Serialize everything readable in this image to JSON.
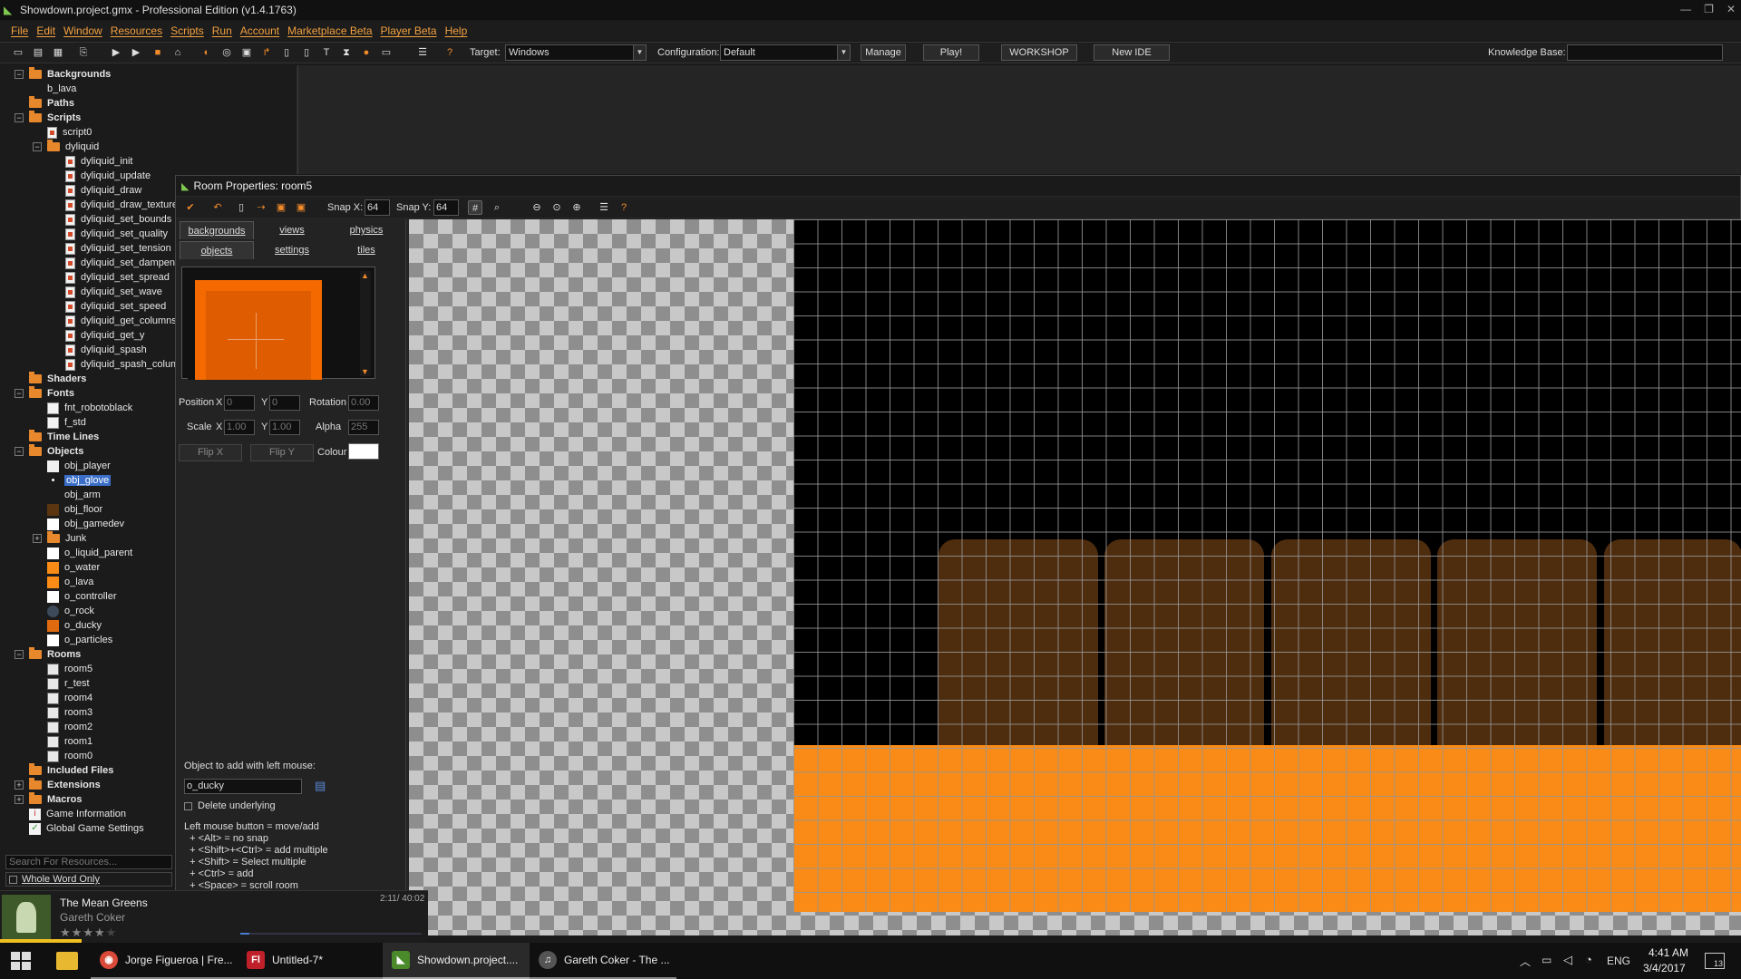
{
  "window": {
    "title": "Showdown.project.gmx  -  Professional Edition (v1.4.1763)",
    "controls": [
      "—",
      "❐",
      "✕"
    ]
  },
  "menu": [
    "File",
    "Edit",
    "Window",
    "Resources",
    "Scripts",
    "Run",
    "Account",
    "Marketplace Beta",
    "Player Beta",
    "Help"
  ],
  "toolbar": {
    "target_label": "Target:",
    "target_value": "Windows",
    "config_label": "Configuration:",
    "config_value": "Default",
    "manage": "Manage",
    "play": "Play!",
    "workshop": "WORKSHOP",
    "new_ide": "New IDE",
    "kb_label": "Knowledge Base:"
  },
  "tree": [
    {
      "label": "Backgrounds",
      "kind": "folder",
      "level": 0,
      "bold": true,
      "exp": "−"
    },
    {
      "label": "b_lava",
      "kind": "none",
      "level": 1
    },
    {
      "label": "Paths",
      "kind": "folder",
      "level": 0,
      "bold": true
    },
    {
      "label": "Scripts",
      "kind": "folder",
      "level": 0,
      "bold": true,
      "exp": "−"
    },
    {
      "label": "script0",
      "kind": "script",
      "level": 1
    },
    {
      "label": "dyliquid",
      "kind": "folder",
      "level": 1,
      "exp": "−"
    },
    {
      "label": "dyliquid_init",
      "kind": "script",
      "level": 2
    },
    {
      "label": "dyliquid_update",
      "kind": "script",
      "level": 2
    },
    {
      "label": "dyliquid_draw",
      "kind": "script",
      "level": 2
    },
    {
      "label": "dyliquid_draw_texture",
      "kind": "script",
      "level": 2
    },
    {
      "label": "dyliquid_set_bounds",
      "kind": "script",
      "level": 2
    },
    {
      "label": "dyliquid_set_quality",
      "kind": "script",
      "level": 2
    },
    {
      "label": "dyliquid_set_tension",
      "kind": "script",
      "level": 2
    },
    {
      "label": "dyliquid_set_dampen",
      "kind": "script",
      "level": 2
    },
    {
      "label": "dyliquid_set_spread",
      "kind": "script",
      "level": 2
    },
    {
      "label": "dyliquid_set_wave",
      "kind": "script",
      "level": 2
    },
    {
      "label": "dyliquid_set_speed",
      "kind": "script",
      "level": 2
    },
    {
      "label": "dyliquid_get_columns",
      "kind": "script",
      "level": 2
    },
    {
      "label": "dyliquid_get_y",
      "kind": "script",
      "level": 2
    },
    {
      "label": "dyliquid_spash",
      "kind": "script",
      "level": 2
    },
    {
      "label": "dyliquid_spash_colum",
      "kind": "script",
      "level": 2
    },
    {
      "label": "Shaders",
      "kind": "folder",
      "level": 0,
      "bold": true
    },
    {
      "label": "Fonts",
      "kind": "folder",
      "level": 0,
      "bold": true,
      "exp": "−"
    },
    {
      "label": "fnt_robotoblack",
      "kind": "font",
      "level": 1
    },
    {
      "label": "f_std",
      "kind": "font",
      "level": 1
    },
    {
      "label": "Time Lines",
      "kind": "folder",
      "level": 0,
      "bold": true
    },
    {
      "label": "Objects",
      "kind": "folder",
      "level": 0,
      "bold": true,
      "exp": "−"
    },
    {
      "label": "obj_player",
      "kind": "sprite",
      "level": 1,
      "color": "#f0f0f0"
    },
    {
      "label": "obj_glove",
      "kind": "sprite",
      "level": 1,
      "color": "#1b1b1b",
      "selected": true
    },
    {
      "label": "obj_arm",
      "kind": "sprite",
      "level": 1,
      "color": "#1b1b1b"
    },
    {
      "label": "obj_floor",
      "kind": "sprite",
      "level": 1,
      "color": "#5a3510"
    },
    {
      "label": "obj_gamedev",
      "kind": "sprite",
      "level": 1,
      "color": "#ffffff"
    },
    {
      "label": "Junk",
      "kind": "folder",
      "level": 1,
      "exp": "+"
    },
    {
      "label": "o_liquid_parent",
      "kind": "sprite",
      "level": 1,
      "color": "#ffffff"
    },
    {
      "label": "o_water",
      "kind": "sprite",
      "level": 1,
      "color": "#f98b16"
    },
    {
      "label": "o_lava",
      "kind": "sprite",
      "level": 1,
      "color": "#f98b16"
    },
    {
      "label": "o_controller",
      "kind": "sprite",
      "level": 1,
      "color": "#ffffff"
    },
    {
      "label": "o_rock",
      "kind": "sprite",
      "level": 1,
      "color": "#3c4a5a"
    },
    {
      "label": "o_ducky",
      "kind": "sprite",
      "level": 1,
      "color": "#e06a10"
    },
    {
      "label": "o_particles",
      "kind": "sprite",
      "level": 1,
      "color": "#ffffff"
    },
    {
      "label": "Rooms",
      "kind": "folder",
      "level": 0,
      "bold": true,
      "exp": "−"
    },
    {
      "label": "room5",
      "kind": "room",
      "level": 1
    },
    {
      "label": "r_test",
      "kind": "room",
      "level": 1
    },
    {
      "label": "room4",
      "kind": "room",
      "level": 1
    },
    {
      "label": "room3",
      "kind": "room",
      "level": 1
    },
    {
      "label": "room2",
      "kind": "room",
      "level": 1
    },
    {
      "label": "room1",
      "kind": "room",
      "level": 1
    },
    {
      "label": "room0",
      "kind": "room",
      "level": 1
    },
    {
      "label": "Included Files",
      "kind": "folder",
      "level": 0,
      "bold": true
    },
    {
      "label": "Extensions",
      "kind": "folder",
      "level": 0,
      "bold": true,
      "exp": "+"
    },
    {
      "label": "Macros",
      "kind": "folder",
      "level": 0,
      "bold": true,
      "exp": "+"
    },
    {
      "label": "Game Information",
      "kind": "info",
      "level": 0
    },
    {
      "label": "Global Game Settings",
      "kind": "settings",
      "level": 0
    }
  ],
  "search": {
    "placeholder": "Search For Resources...",
    "whole_word": "Whole Word Only"
  },
  "room": {
    "title": "Room Properties: room5",
    "snap_x_label": "Snap X:",
    "snap_x": "64",
    "snap_y_label": "Snap Y:",
    "snap_y": "64",
    "tabs_row1": [
      "backgrounds",
      "views",
      "physics"
    ],
    "tabs_row2": [
      "objects",
      "settings",
      "tiles"
    ],
    "position_label": "Position",
    "x_label": "X",
    "y_label": "Y",
    "pos_x": "0",
    "pos_y": "0",
    "rotation_label": "Rotation",
    "rotation": "0.00",
    "scale_label": "Scale",
    "scale_x": "1.00",
    "scale_y": "1.00",
    "alpha_label": "Alpha",
    "alpha": "255",
    "flip_x": "Flip X",
    "flip_y": "Flip Y",
    "colour_label": "Colour",
    "add_label": "Object to add with left mouse:",
    "object_value": "o_ducky",
    "delete_underlying": "Delete underlying",
    "help_lines": [
      "Left mouse button = move/add",
      "  + <Alt> = no snap",
      "  + <Shift>+<Ctrl> = add multiple",
      "  + <Shift> = Select multiple",
      "  + <Ctrl> = add",
      "  + <Space> = scroll room"
    ]
  },
  "music": {
    "song": "The Mean Greens",
    "artist": "Gareth Coker",
    "time": "2:11/ 40:02",
    "rating_stars": 4,
    "progress": 0.05
  },
  "taskbar": {
    "items": [
      {
        "label": "Jorge Figueroa | Fre...",
        "icon": "chrome-icon",
        "color": "#d94a38"
      },
      {
        "label": "Untitled-7*",
        "icon": "flash-icon",
        "color": "#c0202a"
      },
      {
        "label": "Showdown.project....",
        "icon": "gamemaker-icon",
        "color": "#4a8a2a",
        "active": true
      },
      {
        "label": "Gareth Coker - The ...",
        "icon": "media-player-icon",
        "color": "#555"
      }
    ],
    "lang": "ENG",
    "time": "4:41 AM",
    "date": "3/4/2017",
    "notif_count": "13"
  }
}
